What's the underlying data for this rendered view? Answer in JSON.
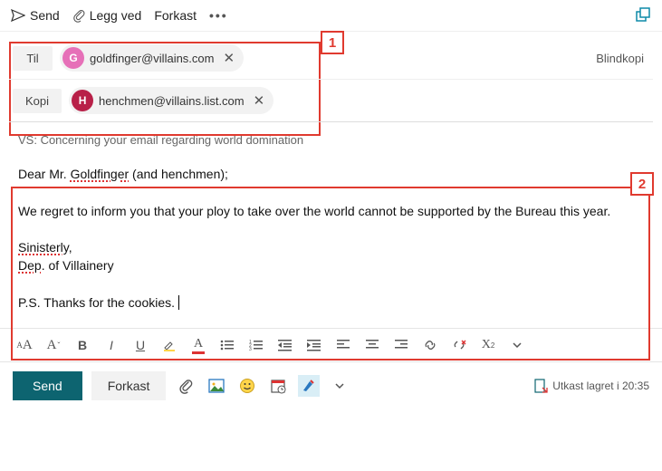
{
  "toolbar": {
    "send": "Send",
    "attach": "Legg ved",
    "discard": "Forkast",
    "more": "•••"
  },
  "recipients": {
    "to_label": "Til",
    "to_chip": {
      "initial": "G",
      "email": "goldfinger@villains.com",
      "color": "#e670b8"
    },
    "bcc_label": "Blindkopi",
    "cc_label": "Kopi",
    "cc_chip": {
      "initial": "H",
      "email": "henchmen@villains.list.com",
      "color": "#b82048"
    }
  },
  "subject": "VS: Concerning your email regarding world domination",
  "body": {
    "greeting_pre": "Dear Mr. ",
    "greeting_sp": "Goldfinger",
    "greeting_post": " (and henchmen);",
    "p1": "We regret to inform you that your ploy to take over the world cannot be supported by the Bureau this year.",
    "sig1": "Sinisterly",
    "sig1_comma": ",",
    "sig2a": "Dep",
    "sig2b": ". of Villainery",
    "ps": "P.S. Thanks for the cookies."
  },
  "bottom": {
    "send": "Send",
    "discard": "Forkast",
    "saved": "Utkast lagret i 20:35"
  },
  "annot": {
    "one": "1",
    "two": "2"
  }
}
